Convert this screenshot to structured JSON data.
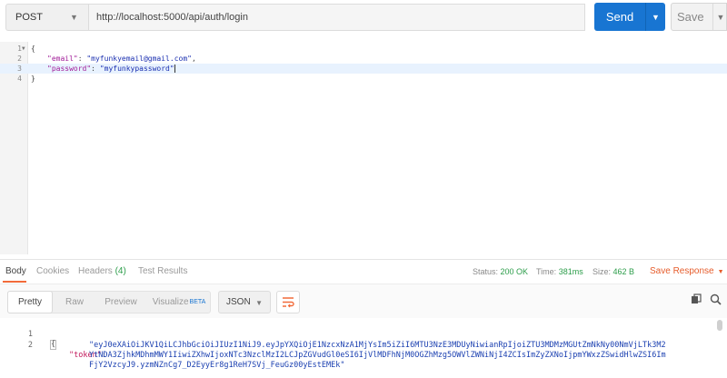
{
  "request": {
    "method": "POST",
    "url": "http://localhost:5000/api/auth/login",
    "send_label": "Send",
    "save_label": "Save"
  },
  "editor": {
    "lines": [
      {
        "num": "1",
        "text": "{"
      },
      {
        "num": "2",
        "key": "\"email\"",
        "sep": ": ",
        "value": "\"myfunkyemail@gmail.com\"",
        "tail": ","
      },
      {
        "num": "3",
        "key": "\"password\"",
        "sep": ": ",
        "value": "\"myfunkypassword\"",
        "tail": ""
      },
      {
        "num": "4",
        "text": "}"
      }
    ]
  },
  "response_tabs": {
    "body": "Body",
    "cookies": "Cookies",
    "headers": "Headers",
    "headers_count": "(4)",
    "test_results": "Test Results"
  },
  "response_meta": {
    "status_label": "Status:",
    "status_value": "200 OK",
    "time_label": "Time:",
    "time_value": "381ms",
    "size_label": "Size:",
    "size_value": "462 B",
    "save_response": "Save Response"
  },
  "response_toolbar": {
    "pretty": "Pretty",
    "raw": "Raw",
    "preview": "Preview",
    "visualize": "Visualize",
    "beta": "BETA",
    "format": "JSON"
  },
  "response_body": {
    "line1_num": "1",
    "line1": "{",
    "line2_num": "2",
    "key": "\"token\"",
    "sep": ":",
    "token_line1": "\"eyJ0eXAiOiJKV1QiLCJhbGciOiJIUzI1NiJ9.eyJpYXQiOjE1NzcxNzA1MjYsIm5iZiI6MTU3NzE3MDUyNiwianRpIjoiZTU3MDMzMGUtZmNkNy00NmVjLTk3M2",
    "token_line2": "YtNDA3ZjhkMDhmMWY1IiwiZXhwIjoxNTc3NzclMzI2LCJpZGVudGl0eSI6IjVlMDFhNjM0OGZhMzg5OWVlZWNiNjI4ZCIsImZyZXNoIjpmYWxzZSwidHlwZSI6Im",
    "token_line3": "FjY2VzcyJ9.yzmNZnCg7_D2EyyEr8g1ReH7SVj_FeuGz00yEstEMEk\""
  }
}
